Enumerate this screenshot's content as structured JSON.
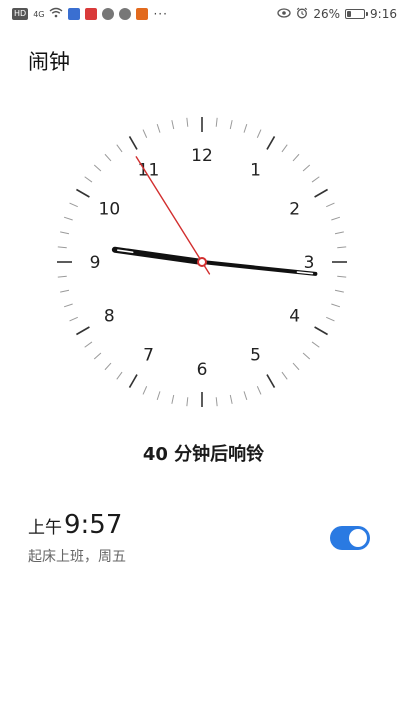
{
  "status_bar": {
    "left_icons": [
      {
        "name": "hd-icon",
        "text": "HD",
        "style": ""
      },
      {
        "name": "signal-icon",
        "text": "4G",
        "style": "sup"
      },
      {
        "name": "wifi-icon",
        "text": "",
        "style": ""
      },
      {
        "name": "app-notification-icon-1",
        "text": "",
        "style": "blue"
      },
      {
        "name": "app-notification-icon-2",
        "text": "",
        "style": "red"
      },
      {
        "name": "app-notification-icon-3",
        "text": "",
        "style": "gray"
      },
      {
        "name": "app-notification-icon-4",
        "text": "",
        "style": "gray"
      },
      {
        "name": "app-notification-icon-5",
        "text": "",
        "style": "orange"
      }
    ],
    "more": "···",
    "battery_percent": "26%",
    "battery_level": 0.26,
    "time": "9:16"
  },
  "page": {
    "title": "闹钟"
  },
  "clock": {
    "numerals": [
      "12",
      "1",
      "2",
      "3",
      "4",
      "5",
      "6",
      "7",
      "8",
      "9",
      "10",
      "11"
    ],
    "hour": 9,
    "minute": 16,
    "second_angle_deg": 328,
    "colors": {
      "hands": "#111111",
      "second_hand": "#d22f2f",
      "ticks_major": "#333333",
      "ticks_minor": "#9a9a9a",
      "numerals": "#222222"
    }
  },
  "countdown": {
    "text": "40 分钟后响铃"
  },
  "alarm": {
    "period": "上午",
    "time": "9:57",
    "label": "起床上班，周五",
    "enabled": true,
    "accent": "#2a7ae2"
  }
}
